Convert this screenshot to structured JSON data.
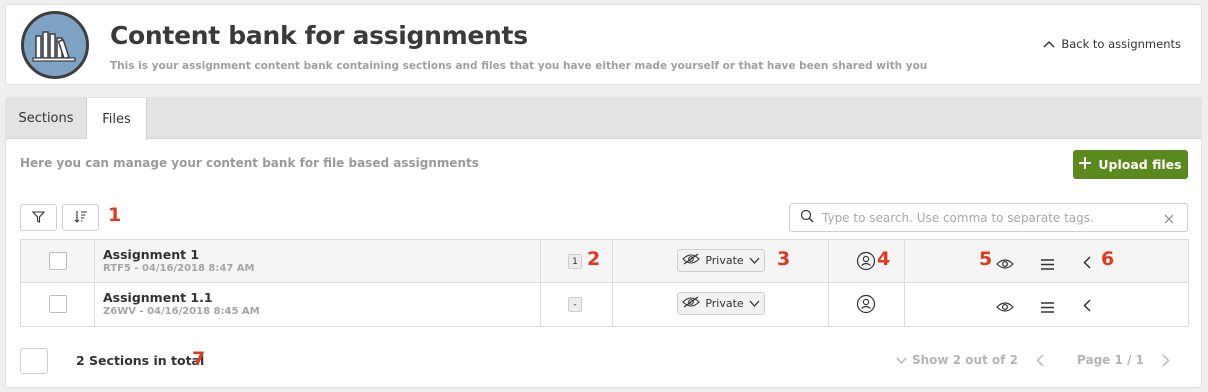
{
  "header": {
    "title": "Content bank for assignments",
    "subtitle": "This is your assignment content bank containing sections and files that you have either made yourself or that have been shared with you",
    "back_label": "Back to assignments"
  },
  "tabs": [
    {
      "label": "Sections",
      "active": false
    },
    {
      "label": "Files",
      "active": true
    }
  ],
  "toolbar": {
    "description": "Here you can manage your content bank for file based assignments",
    "upload_label": "Upload files",
    "search_placeholder": "Type to search. Use comma to separate tags."
  },
  "annotations": [
    "1",
    "2",
    "3",
    "4",
    "5",
    "6",
    "7"
  ],
  "rows": [
    {
      "name": "Assignment 1",
      "meta": "RTF5 - 04/16/2018 8:47 AM",
      "count": "1",
      "visibility": "Private"
    },
    {
      "name": "Assignment 1.1",
      "meta": "Z6WV - 04/16/2018 8:45 AM",
      "count": "-",
      "visibility": "Private"
    }
  ],
  "footer": {
    "total": "2 Sections in total",
    "show": "Show 2 out of 2",
    "page": "Page 1 / 1"
  },
  "colors": {
    "accent_green": "#5a8a1e",
    "annotation_red": "#e03a1e",
    "logo_blue": "#7ea2c3"
  }
}
